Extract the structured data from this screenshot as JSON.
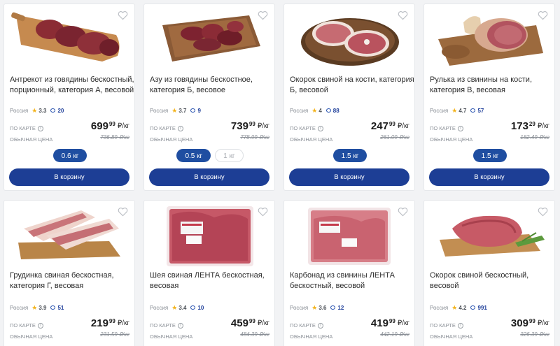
{
  "products": [
    {
      "title": "Антрекот из говядины бескостный, порционный, категория А, весовой",
      "country": "Россия",
      "rating": "3.3",
      "reviews": "20",
      "card_label": "ПО КАРТЕ",
      "regular_label": "ОБЫЧНАЯ ЦЕНА",
      "price_main": "699",
      "price_cents": "99",
      "unit": "₽/кг",
      "old_price": "736.89 ₽/кг",
      "weights": [
        "0.6 кг"
      ],
      "cart_label": "В корзину"
    },
    {
      "title": "Азу из говядины бескостное, категория Б, весовое",
      "country": "Россия",
      "rating": "3.7",
      "reviews": "9",
      "card_label": "ПО КАРТЕ",
      "regular_label": "ОБЫЧНАЯ ЦЕНА",
      "price_main": "739",
      "price_cents": "99",
      "unit": "₽/кг",
      "old_price": "778.99 ₽/кг",
      "weights": [
        "0.5 кг",
        "1 кг"
      ],
      "cart_label": "В корзину"
    },
    {
      "title": "Окорок свиной на кости, категория Б, весовой",
      "country": "Россия",
      "rating": "4",
      "reviews": "88",
      "card_label": "ПО КАРТЕ",
      "regular_label": "ОБЫЧНАЯ ЦЕНА",
      "price_main": "247",
      "price_cents": "99",
      "unit": "₽/кг",
      "old_price": "261.09 ₽/кг",
      "weights": [
        "1.5 кг"
      ],
      "cart_label": "В корзину"
    },
    {
      "title": "Рулька из свинины на кости, категория В, весовая",
      "country": "Россия",
      "rating": "4.7",
      "reviews": "57",
      "card_label": "ПО КАРТЕ",
      "regular_label": "ОБЫЧНАЯ ЦЕНА",
      "price_main": "173",
      "price_cents": "29",
      "unit": "₽/кг",
      "old_price": "182.49 ₽/кг",
      "weights": [
        "1.5 кг"
      ],
      "cart_label": "В корзину"
    },
    {
      "title": "Грудинка свиная бескостная, категория Г, весовая",
      "country": "Россия",
      "rating": "3.9",
      "reviews": "51",
      "card_label": "ПО КАРТЕ",
      "regular_label": "ОБЫЧНАЯ ЦЕНА",
      "price_main": "219",
      "price_cents": "99",
      "unit": "₽/кг",
      "old_price": "231.59 ₽/кг"
    },
    {
      "title": "Шея свиная ЛЕНТА бескостная, весовая",
      "country": "Россия",
      "rating": "3.4",
      "reviews": "10",
      "card_label": "ПО КАРТЕ",
      "regular_label": "ОБЫЧНАЯ ЦЕНА",
      "price_main": "459",
      "price_cents": "99",
      "unit": "₽/кг",
      "old_price": "484.39 ₽/кг"
    },
    {
      "title": "Карбонад из свинины ЛЕНТА бескостный, весовой",
      "country": "Россия",
      "rating": "3.6",
      "reviews": "12",
      "card_label": "ПО КАРТЕ",
      "regular_label": "ОБЫЧНАЯ ЦЕНА",
      "price_main": "419",
      "price_cents": "99",
      "unit": "₽/кг",
      "old_price": "442.19 ₽/кг"
    },
    {
      "title": "Окорок свиной бескостный, весовой",
      "country": "Россия",
      "rating": "4.2",
      "reviews": "991",
      "card_label": "ПО КАРТЕ",
      "regular_label": "ОБЫЧНАЯ ЦЕНА",
      "price_main": "309",
      "price_cents": "99",
      "unit": "₽/кг",
      "old_price": "326.39 ₽/кг"
    }
  ],
  "colors": {
    "primary": "#1d3e95",
    "chip_active": "#1f4ea1",
    "star": "#f3b31b"
  },
  "icons": {
    "favorite": "heart-outline-icon",
    "rating": "star-icon",
    "reviews": "comment-bubble-icon",
    "info": "info-circle-icon"
  }
}
